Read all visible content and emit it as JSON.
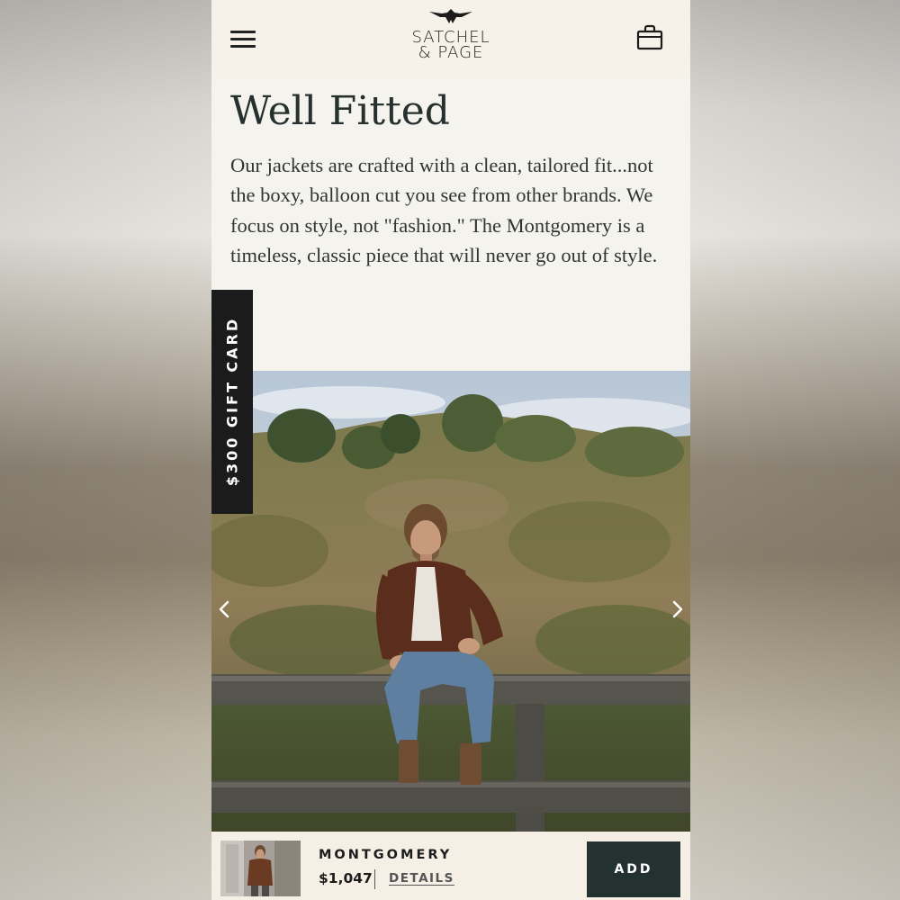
{
  "header": {
    "menu_icon": "hamburger-menu-icon",
    "logo_line1": "SATCHEL",
    "logo_line2": "& PAGE",
    "logo_icon": "eagle-emblem-icon",
    "cart_icon": "shopping-bag-icon"
  },
  "main": {
    "title": "Well Fitted",
    "body": "Our jackets are crafted with a clean, tailored fit...not the boxy, balloon cut you see from other brands. We focus on style, not \"fashion.\" The Montgomery is a timeless, classic piece that will never go out of style."
  },
  "gift_tab": {
    "label": "$300 GIFT CARD"
  },
  "carousel": {
    "prev_icon": "chevron-left-icon",
    "next_icon": "chevron-right-icon",
    "image": "man in brown suede jacket sitting on wooden fence"
  },
  "bottom_bar": {
    "product_name": "MONTGOMERY",
    "price": "$1,047",
    "details_label": "DETAILS",
    "add_label": "ADD"
  },
  "colors": {
    "page_background": "#f5f3ee",
    "header_background": "#f6f1e9",
    "heading_text": "#26302f",
    "add_button": "#243131",
    "gift_tab": "#1b1b1b"
  }
}
